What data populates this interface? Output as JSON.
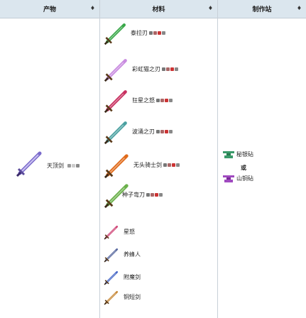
{
  "headers": {
    "product": "产物",
    "materials": "材料",
    "station": "制作站",
    "sort_symbol": "♦"
  },
  "product": {
    "name": "天顶剑",
    "icon": "zenith-sword-icon",
    "color": "#7a6acb"
  },
  "materials": [
    {
      "name": "泰拉刃",
      "icon": "terra-blade-icon",
      "color": "#3aa84a"
    },
    {
      "name": "彩虹猫之刃",
      "icon": "meowmere-icon",
      "color": "#c98be0"
    },
    {
      "name": "狂星之怒",
      "icon": "star-wrath-icon",
      "color": "#c83060"
    },
    {
      "name": "波涌之刃",
      "icon": "influx-waver-icon",
      "color": "#4aa0a0"
    },
    {
      "name": "无头骑士剑",
      "icon": "horsemans-blade-icon",
      "color": "#e06a1a"
    },
    {
      "name": "种子弯刀",
      "icon": "seedler-icon",
      "color": "#6ab04a"
    },
    {
      "name": "星怒",
      "icon": "starfury-icon",
      "color": "#d04a7a"
    },
    {
      "name": "养蜂人",
      "icon": "bee-keeper-icon",
      "color": "#5a6aa0"
    },
    {
      "name": "附魔剑",
      "icon": "enchanted-sword-icon",
      "color": "#4a6ac8"
    },
    {
      "name": "铜短剑",
      "icon": "copper-sword-icon",
      "color": "#c88a3a"
    }
  ],
  "stations": {
    "first": "秘银砧",
    "or": "或",
    "second": "山铜砧",
    "first_color": "#3a9a6a",
    "second_color": "#a04ac0"
  }
}
